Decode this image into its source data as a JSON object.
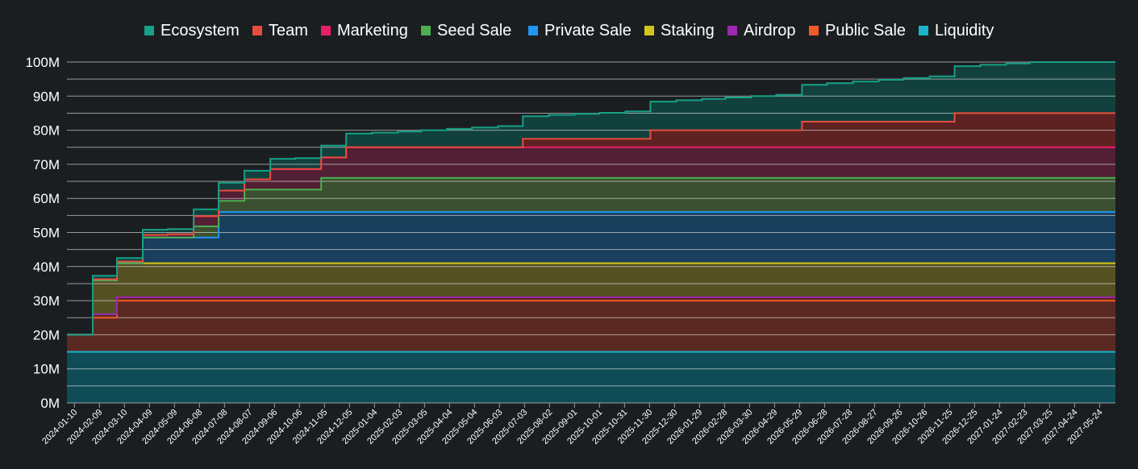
{
  "chart_data": {
    "type": "area",
    "stacked": true,
    "step": true,
    "legend_position": "top",
    "grid": true,
    "ylim": [
      0,
      100
    ],
    "y_unit": "M",
    "y_ticks": [
      "0M",
      "10M",
      "20M",
      "30M",
      "40M",
      "50M",
      "60M",
      "70M",
      "80M",
      "90M",
      "100M"
    ],
    "x_tick_labels": [
      "2024-01-10",
      "2024-02-09",
      "2024-03-10",
      "2024-04-09",
      "2024-05-09",
      "2024-06-08",
      "2024-07-08",
      "2024-08-07",
      "2024-09-06",
      "2024-10-06",
      "2024-11-05",
      "2024-12-05",
      "2025-01-04",
      "2025-02-03",
      "2025-03-05",
      "2025-04-04",
      "2025-05-04",
      "2025-06-03",
      "2025-07-03",
      "2025-08-02",
      "2025-09-01",
      "2025-10-01",
      "2025-10-31",
      "2025-11-30",
      "2025-12-30",
      "2026-01-29",
      "2026-02-28",
      "2026-03-30",
      "2026-04-29",
      "2026-05-29",
      "2026-06-28",
      "2026-07-28",
      "2026-08-27",
      "2026-09-26",
      "2026-10-26",
      "2026-11-25",
      "2026-12-25",
      "2027-01-24",
      "2027-02-23",
      "2027-03-25",
      "2027-04-24",
      "2027-05-24"
    ],
    "x_start": "2024-01-01",
    "x_end": "2027-06-12",
    "series": [
      {
        "name": "Liquidity",
        "color": "#1ab3c9",
        "fill": "#0f4c55",
        "points": [
          [
            "2024-01-01",
            15
          ]
        ]
      },
      {
        "name": "Public Sale",
        "color": "#f05a28",
        "fill": "#5a2a22",
        "points": [
          [
            "2024-01-01",
            5
          ],
          [
            "2024-02-01",
            10
          ],
          [
            "2024-03-01",
            15
          ]
        ]
      },
      {
        "name": "Airdrop",
        "color": "#9c27b0",
        "fill": "#5a2a22",
        "points": [
          [
            "2024-01-01",
            0
          ],
          [
            "2024-02-01",
            1
          ],
          [
            "2024-03-01",
            1
          ]
        ]
      },
      {
        "name": "Staking",
        "color": "#d4c51a",
        "fill": "#555022",
        "points": [
          [
            "2024-01-01",
            0
          ],
          [
            "2024-02-01",
            10
          ],
          [
            "2024-03-01",
            10
          ]
        ]
      },
      {
        "name": "Private Sale",
        "color": "#2196f3",
        "fill": "#1a3f5c",
        "points": [
          [
            "2024-01-01",
            0
          ],
          [
            "2024-04-01",
            7.5
          ],
          [
            "2024-07-01",
            15
          ]
        ]
      },
      {
        "name": "Seed Sale",
        "color": "#4caf50",
        "fill": "#3a5030",
        "points": [
          [
            "2024-01-01",
            0
          ],
          [
            "2024-06-01",
            3.3
          ],
          [
            "2024-07-01",
            3.3
          ],
          [
            "2024-08-01",
            6.6
          ],
          [
            "2024-11-01",
            10
          ]
        ]
      },
      {
        "name": "Marketing",
        "color": "#e91e63",
        "fill": "#521f35",
        "points": [
          [
            "2024-01-01",
            0
          ],
          [
            "2024-02-01",
            0.3
          ],
          [
            "2024-03-01",
            0.5
          ],
          [
            "2024-04-01",
            0.8
          ],
          [
            "2024-05-01",
            1
          ],
          [
            "2024-06-01",
            3
          ],
          [
            "2024-07-01",
            3
          ],
          [
            "2024-08-01",
            3
          ],
          [
            "2024-09-01",
            6
          ],
          [
            "2024-11-01",
            6
          ],
          [
            "2024-12-01",
            9
          ]
        ]
      },
      {
        "name": "Team",
        "color": "#e84c3d",
        "fill": "#5e2222",
        "points": [
          [
            "2024-01-01",
            0
          ],
          [
            "2025-07-01",
            2.5
          ],
          [
            "2025-12-01",
            5
          ],
          [
            "2026-06-01",
            7.5
          ],
          [
            "2026-12-01",
            10
          ]
        ]
      },
      {
        "name": "Ecosystem",
        "color": "#16a085",
        "fill": "#12403c",
        "points": [
          [
            "2024-01-01",
            0
          ],
          [
            "2024-02-01",
            1
          ],
          [
            "2024-03-01",
            1
          ],
          [
            "2024-04-01",
            1.5
          ],
          [
            "2024-05-01",
            1.5
          ],
          [
            "2024-06-01",
            2
          ],
          [
            "2024-07-01",
            2.3
          ],
          [
            "2024-08-01",
            2.5
          ],
          [
            "2024-09-01",
            3
          ],
          [
            "2024-10-01",
            3.2
          ],
          [
            "2024-11-01",
            3.5
          ],
          [
            "2024-12-01",
            4
          ],
          [
            "2025-01-01",
            4.3
          ],
          [
            "2025-02-01",
            4.6
          ],
          [
            "2025-03-01",
            5
          ],
          [
            "2025-04-01",
            5.4
          ],
          [
            "2025-05-01",
            5.8
          ],
          [
            "2025-06-01",
            6.2
          ],
          [
            "2025-07-01",
            6.6
          ],
          [
            "2025-08-01",
            7
          ],
          [
            "2025-09-01",
            7.3
          ],
          [
            "2025-10-01",
            7.6
          ],
          [
            "2025-11-01",
            8
          ],
          [
            "2025-12-01",
            8.4
          ],
          [
            "2026-01-01",
            8.8
          ],
          [
            "2026-02-01",
            9.2
          ],
          [
            "2026-03-01",
            9.6
          ],
          [
            "2026-04-01",
            10
          ],
          [
            "2026-05-01",
            10.4
          ],
          [
            "2026-06-01",
            10.8
          ],
          [
            "2026-07-01",
            11.3
          ],
          [
            "2026-08-01",
            11.8
          ],
          [
            "2026-09-01",
            12.3
          ],
          [
            "2026-10-01",
            12.8
          ],
          [
            "2026-11-01",
            13.3
          ],
          [
            "2026-12-01",
            13.8
          ],
          [
            "2027-01-01",
            14.2
          ],
          [
            "2027-02-01",
            14.6
          ],
          [
            "2027-03-01",
            15
          ]
        ]
      }
    ],
    "legend_order": [
      "Ecosystem",
      "Team",
      "Marketing",
      "Seed Sale",
      "Private Sale",
      "Staking",
      "Airdrop",
      "Public Sale",
      "Liquidity"
    ]
  }
}
